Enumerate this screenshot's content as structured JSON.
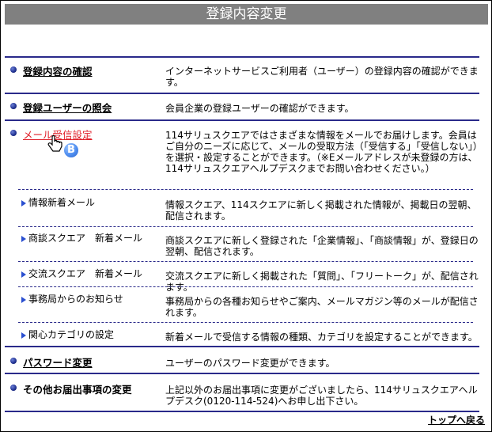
{
  "title": "登録内容変更",
  "sections": [
    {
      "heading": "登録内容の確認",
      "desc": "インターネットサービスご利用者（ユーザー）の登録内容の確認ができます。"
    },
    {
      "heading": "登録ユーザーの照会",
      "desc": "会員企業の登録ユーザーの確認ができます。"
    },
    {
      "heading": "メール受信設定",
      "desc": "114サリュスクエアではさまざまな情報をメールでお届けします。会員はご自分のニーズに応じて、メールの受取方法（「受信する」「受信しない」）を選択・設定することができます。（※Eメールアドレスが未登録の方は、114サリュスクエアヘルプデスクまでお問い合わせください。）",
      "badge": "B",
      "subitems": [
        {
          "label": "情報新着メール",
          "desc": "情報スクエア、114スクエアに新しく掲載された情報が、掲載日の翌朝、配信されます。"
        },
        {
          "label": "商談スクエア　新着メール",
          "desc": "商談スクエアに新しく登録された「企業情報」、「商談情報」が、登録日の翌朝、配信されます。"
        },
        {
          "label": "交流スクエア　新着メール",
          "desc": "交流スクエアに新しく掲載された「質問」、「フリートーク」が、配信されます。"
        },
        {
          "label": "事務局からのお知らせ",
          "desc": "事務局からの各種お知らせやご案内、メールマガジン等のメールが配信されます。"
        },
        {
          "label": "関心カテゴリの設定",
          "desc": "新着メールで受信する情報の種類、カテゴリを設定することができます。"
        }
      ]
    },
    {
      "heading": "パスワード変更",
      "desc": "ユーザーのパスワード変更ができます。"
    },
    {
      "heading": "その他お届出事項の変更",
      "desc": "上記以外のお届出事項に変更がございましたら、114サリュスクエアヘルプデスク(0120-114-524)へお申し出下さい。"
    }
  ],
  "back_to_top": "トップへ戻る",
  "colors": {
    "title_bg": "#808080",
    "rule": "#2a2a8a",
    "active_link": "#e0202a",
    "badge": "#4f8ef0"
  }
}
